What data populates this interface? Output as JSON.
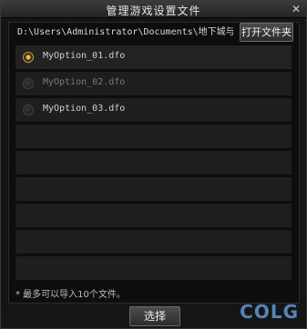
{
  "window": {
    "title": "管理游戏设置文件",
    "close_label": "✕"
  },
  "path": {
    "text": "D:\\Users\\Administrator\\Documents\\地下城与…",
    "open_folder_label": "打开文件夹"
  },
  "files": [
    {
      "name": "MyOption_01.dfo",
      "selected": true,
      "enabled": true
    },
    {
      "name": "MyOption_02.dfo",
      "selected": false,
      "enabled": false
    },
    {
      "name": "MyOption_03.dfo",
      "selected": false,
      "enabled": true
    },
    {
      "name": "",
      "selected": false,
      "enabled": false
    },
    {
      "name": "",
      "selected": false,
      "enabled": false
    },
    {
      "name": "",
      "selected": false,
      "enabled": false
    },
    {
      "name": "",
      "selected": false,
      "enabled": false
    },
    {
      "name": "",
      "selected": false,
      "enabled": false
    },
    {
      "name": "",
      "selected": false,
      "enabled": false
    }
  ],
  "note": "* 最多可以导入10个文件。",
  "footer": {
    "select_label": "选择"
  },
  "watermark": "COLG",
  "colors": {
    "accent": "#f0c040",
    "watermark": "#5f8fc7"
  }
}
